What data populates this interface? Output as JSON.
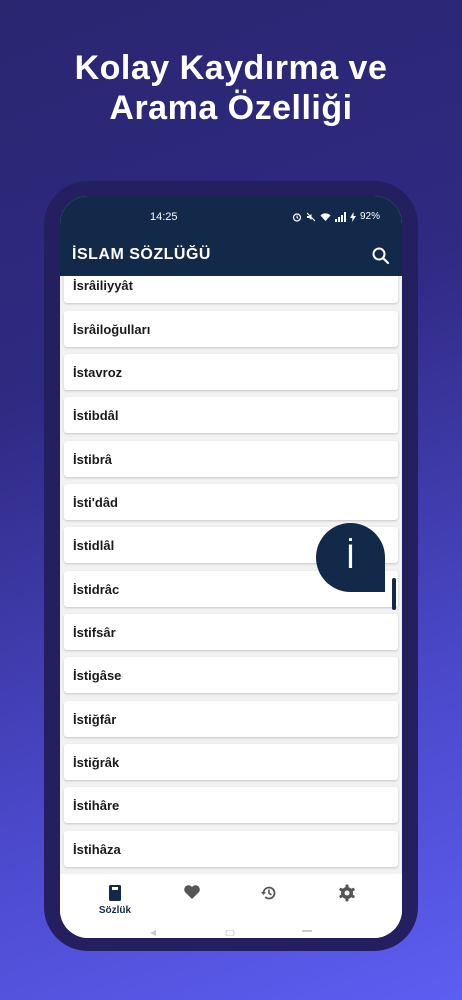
{
  "headline": {
    "line1": "Kolay Kaydırma ve",
    "line2": "Arama Özelliği"
  },
  "status_bar": {
    "time": "14:25",
    "battery": "92%"
  },
  "app_bar": {
    "title": "İSLAM SÖZLÜĞÜ",
    "search_icon": "search-icon"
  },
  "list": {
    "items": [
      "İsrâiliyyât",
      "İsrâiloğulları",
      "İstavroz",
      "İstibdâl",
      "İstibrâ",
      "İsti'dâd",
      "İstidlâl",
      "İstidrâc",
      "İstifsâr",
      "İstigâse",
      "İstiğfâr",
      "İstiğrâk",
      "İstihâre",
      "İstihâza"
    ]
  },
  "fast_scroll": {
    "letter": "İ"
  },
  "bottom_nav": {
    "items": [
      {
        "label": "Sözlük",
        "icon": "book-icon"
      },
      {
        "label": "",
        "icon": "heart-icon"
      },
      {
        "label": "",
        "icon": "history-icon"
      },
      {
        "label": "",
        "icon": "settings-icon"
      }
    ]
  },
  "colors": {
    "primary": "#13294a",
    "background": "#f2f2f2",
    "accent_gradient_end": "#5d5ef2"
  }
}
